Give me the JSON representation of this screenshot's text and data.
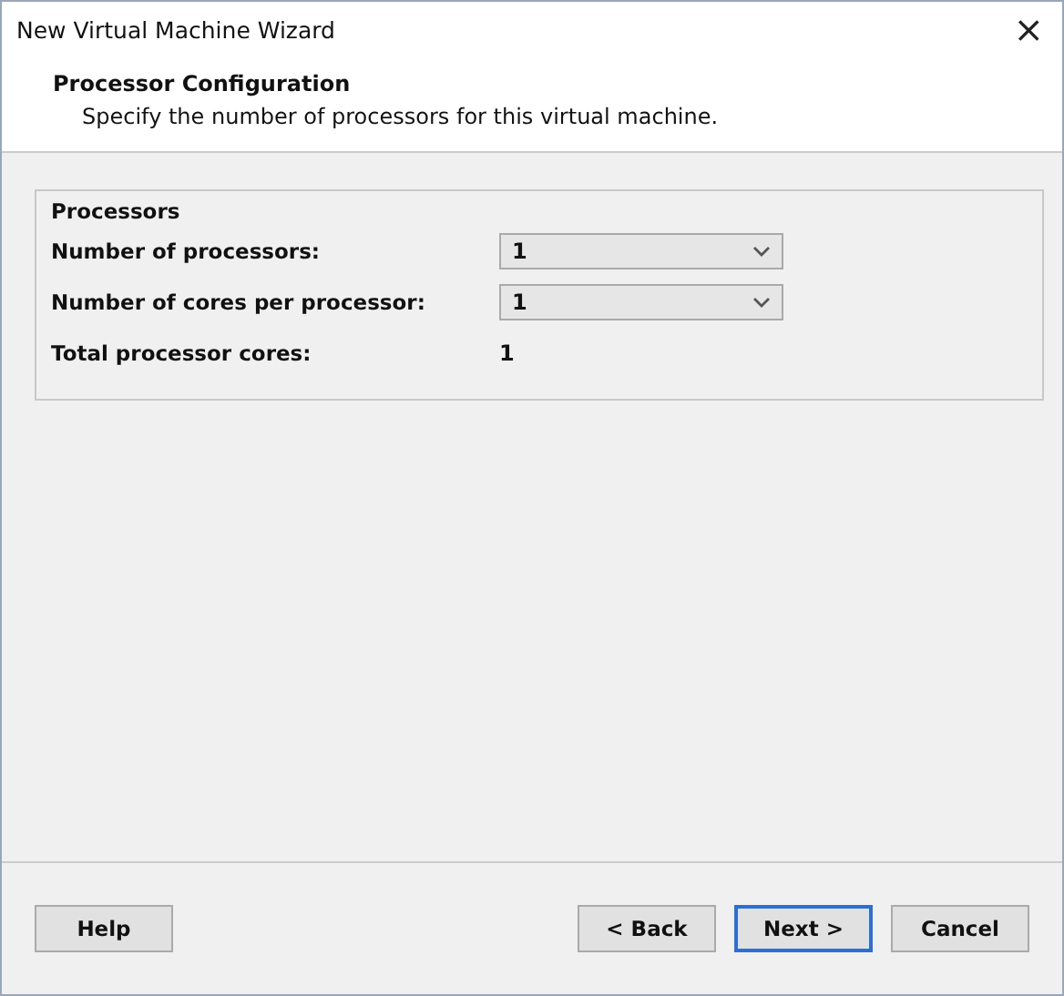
{
  "window": {
    "title": "New Virtual Machine Wizard",
    "close": "×"
  },
  "header": {
    "title": "Processor Configuration",
    "subtitle": "Specify the number of processors for this virtual machine."
  },
  "group": {
    "title": "Processors",
    "rows": [
      {
        "kind": "dropdown",
        "label": "Number of processors:",
        "value": "1"
      },
      {
        "kind": "dropdown",
        "label": "Number of cores per processor:",
        "value": "1"
      },
      {
        "kind": "text",
        "label": "Total processor cores:",
        "value": "1"
      }
    ]
  },
  "buttons": [
    {
      "label": "Help",
      "default": false
    },
    {
      "label": "< Back",
      "default": false
    },
    {
      "label": "Next >",
      "default": true
    },
    {
      "label": "Cancel",
      "default": false
    }
  ]
}
